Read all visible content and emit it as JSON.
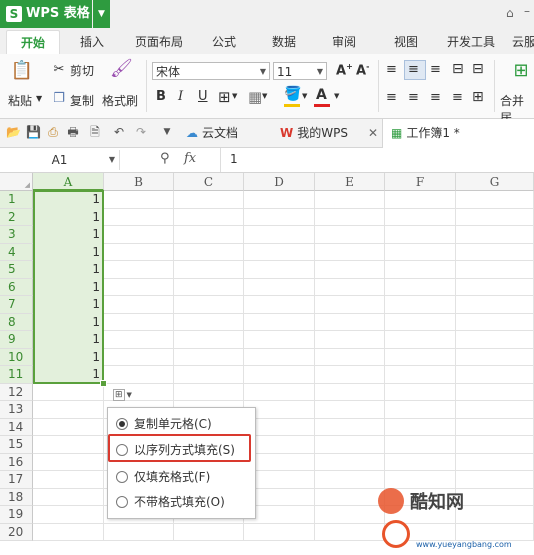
{
  "app": {
    "title": "WPS 表格"
  },
  "ribbon_tabs": [
    "开始",
    "插入",
    "页面布局",
    "公式",
    "数据",
    "审阅",
    "视图",
    "开发工具",
    "云服"
  ],
  "ribbon": {
    "paste": "粘贴",
    "cut": "剪切",
    "copy": "复制",
    "format_painter": "格式刷",
    "font_name": "宋体",
    "font_size": "11",
    "merge": "合并居"
  },
  "doc_tabs": [
    "云文档",
    "我的WPS",
    "工作簿1 *"
  ],
  "formula_bar": {
    "cell_ref": "A1",
    "fx": "fx",
    "value": "1"
  },
  "columns": [
    "A",
    "B",
    "C",
    "D",
    "E",
    "F",
    "G"
  ],
  "rows": [
    "1",
    "2",
    "3",
    "4",
    "5",
    "6",
    "7",
    "8",
    "9",
    "10",
    "11",
    "12",
    "13",
    "14",
    "15",
    "16",
    "17",
    "18",
    "19",
    "20"
  ],
  "cells_A": [
    "1",
    "1",
    "1",
    "1",
    "1",
    "1",
    "1",
    "1",
    "1",
    "1",
    "1"
  ],
  "autofill_menu": {
    "options": [
      "复制单元格(C)",
      "以序列方式填充(S)",
      "仅填充格式(F)",
      "不带格式填充(O)"
    ],
    "selected_index": 0,
    "highlighted_index": 1
  },
  "watermark": {
    "brand": "酷知网",
    "site": "www.yueyangbang.com"
  },
  "colors": {
    "brand": "#2e9b3f",
    "selection": "#e3f0dc",
    "highlight": "#d9392e"
  }
}
